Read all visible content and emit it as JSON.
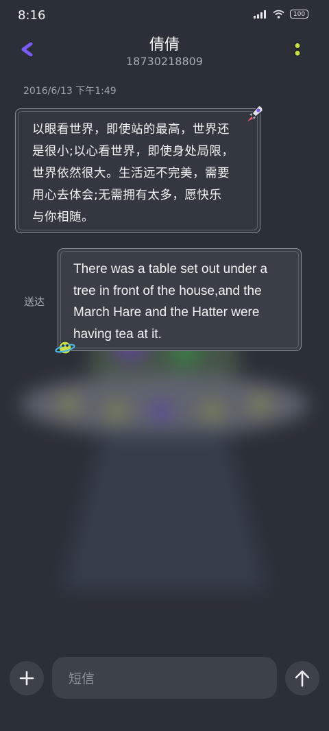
{
  "status_bar": {
    "time": "8:16",
    "battery": "100",
    "icons": [
      "signal-icon",
      "wifi-icon",
      "battery-icon"
    ]
  },
  "header": {
    "contact_name": "倩倩",
    "contact_number": "18730218809",
    "icons": [
      "back-icon",
      "more-icon"
    ]
  },
  "conversation": {
    "timestamp": "2016/6/13 下午1:49",
    "messages": [
      {
        "direction": "incoming",
        "lines": [
          "以眼看世界，即使站的最高，世界还",
          "是很小;以心看世界，即使身处局限，",
          "世界依然很大。生活远不完美，需要",
          "用心去体会;无需拥有太多，愿快乐",
          "与你相随。"
        ]
      },
      {
        "direction": "outgoing",
        "lines": [
          "There was a table set out under a",
          "tree in front of the house,and the",
          "March Hare and the Hatter were",
          "having tea at it."
        ],
        "status": "送达"
      }
    ]
  },
  "composer": {
    "placeholder": "短信",
    "icons": [
      "add-icon",
      "send-arrow-icon"
    ]
  },
  "colors": {
    "background": "#2b2f37",
    "bubble_border": "#8b9098",
    "accent_purple": "#7a5cf0",
    "accent_lime": "#c8e04a"
  }
}
